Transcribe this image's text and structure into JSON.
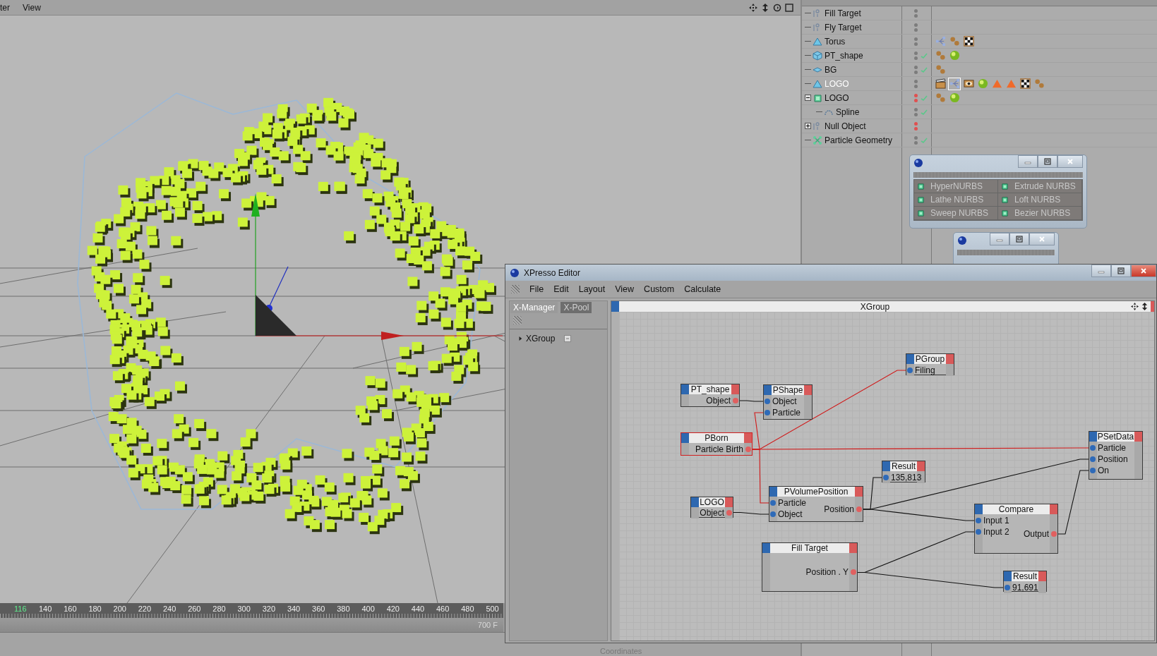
{
  "viewport": {
    "menu": [
      "ter",
      "View"
    ]
  },
  "timeline": {
    "current": "116",
    "labels": [
      "140",
      "160",
      "180",
      "200",
      "220",
      "240",
      "260",
      "280",
      "300",
      "320",
      "340",
      "360",
      "380",
      "400",
      "420",
      "440",
      "460",
      "480",
      "500"
    ],
    "end": "700 F"
  },
  "bottom_tab": "Coordinates",
  "object_manager": {
    "objects": [
      {
        "name": "Fill Target",
        "kind": "null",
        "selected": false,
        "hidden": false,
        "enabled": false
      },
      {
        "name": "Fly Target",
        "kind": "null",
        "selected": false,
        "hidden": false,
        "enabled": false
      },
      {
        "name": "Torus",
        "kind": "polygon",
        "selected": false,
        "hidden": false,
        "enabled": false,
        "tags": [
          {
            "kind": "xpresso",
            "selected": false
          },
          {
            "kind": "phong",
            "selected": false
          },
          {
            "kind": "uvw",
            "selected": false
          }
        ]
      },
      {
        "name": "PT_shape",
        "kind": "cube",
        "selected": false,
        "hidden": false,
        "enabled": true,
        "tags": [
          {
            "kind": "phong",
            "selected": false
          },
          {
            "kind": "material",
            "selected": false
          }
        ]
      },
      {
        "name": "BG",
        "kind": "plane",
        "selected": false,
        "hidden": false,
        "enabled": true,
        "tags": [
          {
            "kind": "phong",
            "selected": false
          }
        ]
      },
      {
        "name": "LOGO",
        "kind": "polygon",
        "selected": true,
        "hidden": false,
        "enabled": false,
        "tags": [
          {
            "kind": "compositing",
            "selected": false
          },
          {
            "kind": "xpresso",
            "selected": true
          },
          {
            "kind": "display",
            "selected": false
          },
          {
            "kind": "material",
            "selected": false
          },
          {
            "kind": "selection",
            "selected": false
          },
          {
            "kind": "selection",
            "selected": false
          },
          {
            "kind": "uvw",
            "selected": false
          },
          {
            "kind": "phong",
            "selected": false
          }
        ]
      },
      {
        "name": "LOGO",
        "kind": "extrude",
        "selected": false,
        "hidden": true,
        "enabled": true,
        "expanded": true,
        "tags": [
          {
            "kind": "phong",
            "selected": false
          },
          {
            "kind": "material",
            "selected": false
          }
        ],
        "children": [
          {
            "name": "Spline",
            "kind": "spline",
            "selected": false,
            "hidden": false,
            "enabled": true
          }
        ]
      },
      {
        "name": "Null Object",
        "kind": "null",
        "selected": false,
        "hidden": true,
        "enabled": false,
        "expanded": false
      },
      {
        "name": "Particle Geometry",
        "kind": "particle_geometry",
        "selected": false,
        "hidden": false,
        "enabled": true
      }
    ]
  },
  "nurbs_palette": {
    "items": [
      {
        "label": "HyperNURBS"
      },
      {
        "label": "Extrude NURBS"
      },
      {
        "label": "Lathe NURBS"
      },
      {
        "label": "Loft NURBS"
      },
      {
        "label": "Sweep NURBS"
      },
      {
        "label": "Bezier NURBS"
      }
    ]
  },
  "xpresso_editor": {
    "title": "XPresso Editor",
    "menu": [
      "File",
      "Edit",
      "Layout",
      "View",
      "Custom",
      "Calculate"
    ],
    "tabs": [
      {
        "label": "X-Manager",
        "selected": true
      },
      {
        "label": "X-Pool",
        "selected": false
      }
    ],
    "tree": [
      {
        "label": "XGroup",
        "expanded": false
      }
    ],
    "canvas_title": "XGroup",
    "nodes": [
      {
        "title": "PT_shape",
        "outputs": [
          "Object"
        ],
        "selected": false
      },
      {
        "title": "PShape",
        "inputs": [
          "Object",
          "Particle"
        ],
        "selected": false
      },
      {
        "title": "PBorn",
        "outputs": [
          "Particle Birth"
        ],
        "selected": true
      },
      {
        "title": "PGroup",
        "inputs": [
          "Filing"
        ],
        "selected": false
      },
      {
        "title": "LOGO",
        "outputs": [
          "Object"
        ],
        "selected": false
      },
      {
        "title": "PVolumePosition",
        "inputs": [
          "Particle",
          "Object"
        ],
        "outputs": [
          "Position"
        ],
        "selected": false
      },
      {
        "title": "Result",
        "inputs": [
          "135,813"
        ],
        "selected": false
      },
      {
        "title": "PSetData",
        "inputs": [
          "Particle",
          "Position",
          "On"
        ],
        "selected": false
      },
      {
        "title": "Compare",
        "inputs": [
          "Input 1",
          "Input 2"
        ],
        "outputs": [
          "Output"
        ],
        "selected": false
      },
      {
        "title": "Fill Target",
        "outputs": [
          "Position . Y"
        ],
        "selected": false
      },
      {
        "title": "Result",
        "inputs": [
          "91,691"
        ],
        "selected": false
      }
    ]
  }
}
